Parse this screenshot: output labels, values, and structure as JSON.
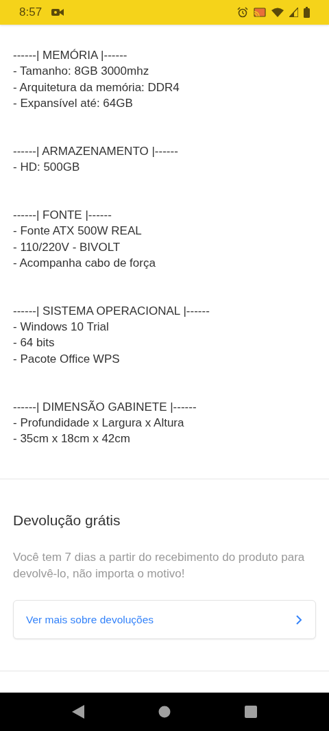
{
  "status_bar": {
    "time": "8:57"
  },
  "description": {
    "sections": [
      {
        "title": "------| MEMÓRIA |------",
        "items": [
          "- Tamanho: 8GB 3000mhz",
          "- Arquitetura da memória: DDR4",
          "- Expansível até: 64GB"
        ]
      },
      {
        "title": "------| ARMAZENAMENTO |------",
        "items": [
          "- HD: 500GB"
        ]
      },
      {
        "title": "------| FONTE |------",
        "items": [
          "- Fonte ATX 500W REAL",
          "- 110/220V - BIVOLT",
          "- Acompanha cabo de força"
        ]
      },
      {
        "title": "------| SISTEMA OPERACIONAL |------",
        "items": [
          "- Windows 10 Trial",
          "- 64 bits",
          "- Pacote Office WPS"
        ]
      },
      {
        "title": "------| DIMENSÃO GABINETE |------",
        "items": [
          "- Profundidade x Largura x Altura",
          "- 35cm x 18cm x 42cm"
        ]
      }
    ]
  },
  "returns": {
    "title": "Devolução grátis",
    "text": "Você tem 7 dias a partir do recebimento do produto para devolvê-lo, não importa o motivo!",
    "link": "Ver mais sobre devoluções"
  }
}
